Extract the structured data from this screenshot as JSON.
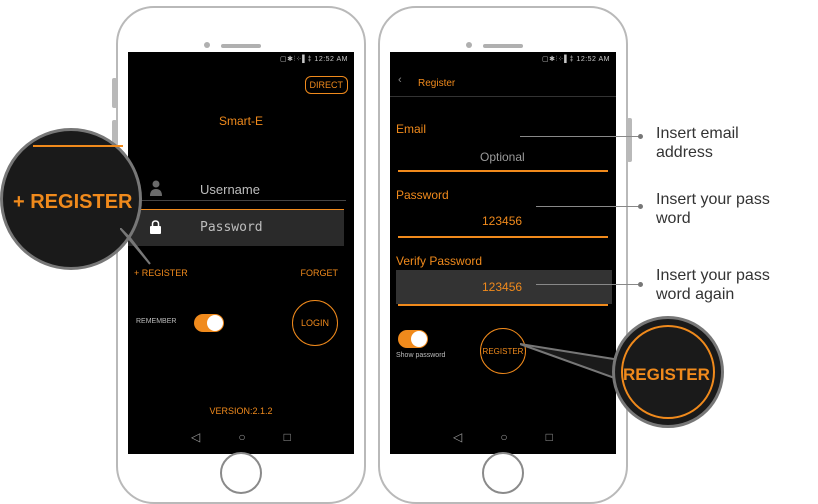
{
  "phone1": {
    "status": "▢✱⫶⁘▌‡ 12:52 AM",
    "direct_label": "DIRECT",
    "app_title": "Smart-E",
    "username_placeholder": "Username",
    "password_placeholder": "Password",
    "register_link": "+ REGISTER",
    "forget_link": "FORGET",
    "remember_label": "REMEMBER",
    "remember_on": true,
    "login_label": "LOGIN",
    "version": "VERSION:2.1.2",
    "zoom_label": "+ REGISTER"
  },
  "phone2": {
    "status": "▢✱⫶⁘▌‡ 12:52 AM",
    "back_title": "Register",
    "email_label": "Email",
    "email_placeholder": "Optional",
    "password_label": "Password",
    "password_value": "123456",
    "verify_label": "Verify Password",
    "verify_value": "123456",
    "show_password_label": "Show password",
    "show_password_on": true,
    "register_button": "REGISTER",
    "zoom_label": "REGISTER"
  },
  "callouts": [
    {
      "line1": "Insert email",
      "line2": "address"
    },
    {
      "line1": "Insert your pass",
      "line2": "word"
    },
    {
      "line1": "Insert your pass",
      "line2": "word again"
    }
  ],
  "nav": {
    "back": "◁",
    "home": "○",
    "recent": "□"
  }
}
